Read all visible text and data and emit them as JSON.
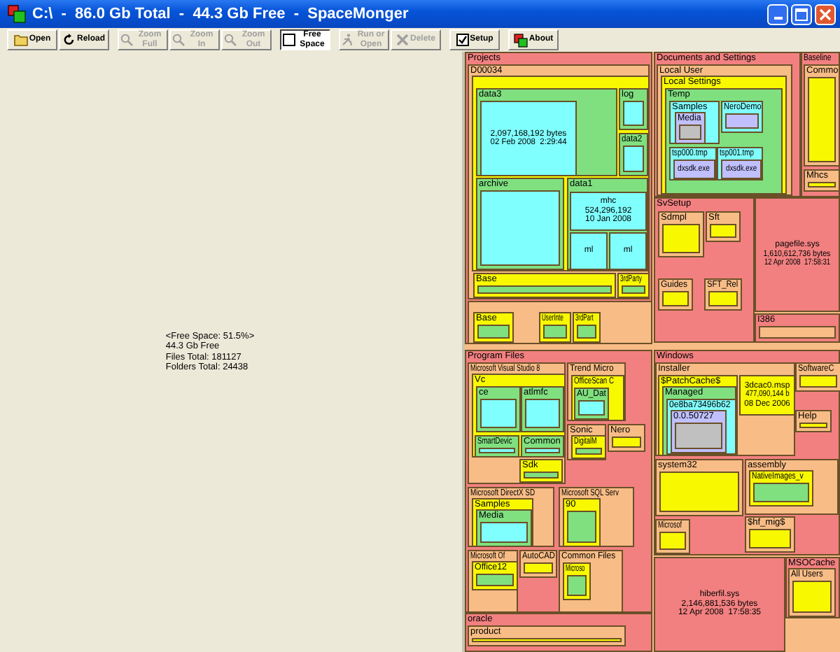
{
  "window": {
    "title": "C:\\  -  86.0 Gb Total  -  44.3 Gb Free  -  SpaceMonger"
  },
  "toolbar": [
    {
      "label": "Open",
      "disabled": false,
      "selected": false
    },
    {
      "label": "Reload",
      "disabled": false,
      "selected": false
    },
    {
      "label": "Zoom Full",
      "disabled": true,
      "selected": false
    },
    {
      "label": "Zoom In",
      "disabled": true,
      "selected": false
    },
    {
      "label": "Zoom Out",
      "disabled": true,
      "selected": false
    },
    {
      "label": "Free Space",
      "disabled": false,
      "selected": true
    },
    {
      "label": "Run or Open",
      "disabled": true,
      "selected": false
    },
    {
      "label": "Delete",
      "disabled": true,
      "selected": false
    },
    {
      "label": "Setup",
      "disabled": false,
      "selected": false
    },
    {
      "label": "About",
      "disabled": false,
      "selected": false
    }
  ],
  "summary": [
    "<Free Space: 51.5%>",
    "44.3 Gb Free",
    "Files Total: 181127",
    "Folders Total: 24438"
  ],
  "treemap": [
    {
      "label": "Projects",
      "children": [
        {
          "label": "D00034",
          "children": [
            {
              "children": [
                {
                  "label": "data3",
                  "children": [
                    {
                      "details": [
                        "2,097,168,192 bytes",
                        "02 Feb 2008  2:29:44"
                      ]
                    }
                  ]
                },
                {
                  "label": "log"
                },
                {
                  "label": "data2"
                },
                {
                  "label": "archive"
                },
                {
                  "label": "data1",
                  "children": [
                    {
                      "details": [
                        "mhc",
                        "524,296,192",
                        "10 Jan 2008"
                      ]
                    },
                    {
                      "details": [
                        "ml"
                      ]
                    },
                    {
                      "details": [
                        "ml"
                      ]
                    }
                  ]
                }
              ]
            },
            {
              "label": "Base"
            },
            {
              "label": "3rdParty"
            }
          ]
        },
        {
          "children": [
            {
              "label": "Base"
            },
            {
              "label": "UserInte"
            },
            {
              "label": "3rdPart"
            }
          ]
        }
      ]
    },
    {
      "label": "Documents and Settings",
      "children": [
        {
          "label": "Local User",
          "children": [
            {
              "label": "Local Settings",
              "children": [
                {
                  "label": "Temp",
                  "children": [
                    {
                      "label": "Samples",
                      "children": [
                        {
                          "label": "Media"
                        }
                      ]
                    },
                    {
                      "label": "NeroDemo"
                    },
                    {
                      "label": "tsp000.tmp",
                      "children": [
                        {
                          "details": [
                            "dxsdk.exe"
                          ]
                        }
                      ]
                    },
                    {
                      "label": "tsp001.tmp",
                      "children": [
                        {
                          "details": [
                            "dxsdk.exe"
                          ]
                        }
                      ]
                    }
                  ]
                }
              ]
            }
          ]
        }
      ]
    },
    {
      "label": "Baseline",
      "children": [
        {
          "label": "Commo"
        },
        {
          "label": "Mhcs"
        }
      ]
    },
    {
      "label": "SvSetup",
      "children": [
        {
          "label": "Sdmpl"
        },
        {
          "label": "Sft"
        },
        {
          "label": "Guides"
        },
        {
          "label": "SFT_Rel"
        }
      ]
    },
    {
      "details": [
        "pagefile.sys",
        "1,610,612,736 bytes",
        "12 Apr 2008  17:58:31"
      ]
    },
    {
      "label": "I386"
    },
    {
      "label": "Program Files",
      "children": [
        {
          "label": "Microsoft Visual Studio 8",
          "children": [
            {
              "label": "Vc",
              "children": [
                {
                  "label": "ce"
                },
                {
                  "label": "atlmfc"
                },
                {
                  "label": "SmartDevic"
                },
                {
                  "label": "Common"
                }
              ]
            },
            {
              "label": "Sdk"
            }
          ]
        },
        {
          "label": "Trend Micro",
          "children": [
            {
              "label": "OfficeScan C",
              "children": [
                {
                  "label": "AU_Dat"
                }
              ]
            }
          ]
        },
        {
          "label": "Sonic",
          "children": [
            {
              "label": "DigitalM"
            }
          ]
        },
        {
          "label": "Nero"
        },
        {
          "label": "Microsoft DirectX SD",
          "children": [
            {
              "label": "Samples",
              "children": [
                {
                  "label": "Media"
                }
              ]
            }
          ]
        },
        {
          "label": "Microsoft SQL Serv",
          "children": [
            {
              "label": "90"
            }
          ]
        },
        {
          "label": "Microsoft Of",
          "children": [
            {
              "label": "Office12"
            }
          ]
        },
        {
          "label": "AutoCAD"
        },
        {
          "label": "Common Files",
          "children": [
            {
              "label": "Microso"
            }
          ]
        }
      ]
    },
    {
      "label": "Windows",
      "children": [
        {
          "label": "Installer",
          "children": [
            {
              "label": "$PatchCache$",
              "children": [
                {
                  "label": "Managed",
                  "children": [
                    {
                      "label": "0e8ba73496b62",
                      "children": [
                        {
                          "label": "0.0.50727"
                        }
                      ]
                    }
                  ]
                }
              ]
            },
            {
              "details": [
                "3dcac0.msp",
                "477,090,144 b",
                "08 Dec 2006"
              ]
            }
          ]
        },
        {
          "label": "SoftwareC"
        },
        {
          "label": "Help"
        },
        {
          "label": "system32"
        },
        {
          "label": "assembly",
          "children": [
            {
              "label": "NativeImages_v"
            }
          ]
        },
        {
          "label": "Microsof"
        },
        {
          "label": "$hf_mig$"
        }
      ]
    },
    {
      "details": [
        "hiberfil.sys",
        "2,146,881,536 bytes",
        "12 Apr 2008  17:58:35"
      ]
    },
    {
      "label": "MSOCache",
      "children": [
        {
          "label": "All Users"
        }
      ]
    },
    {
      "label": "oracle",
      "children": [
        {
          "label": "product"
        }
      ]
    }
  ]
}
